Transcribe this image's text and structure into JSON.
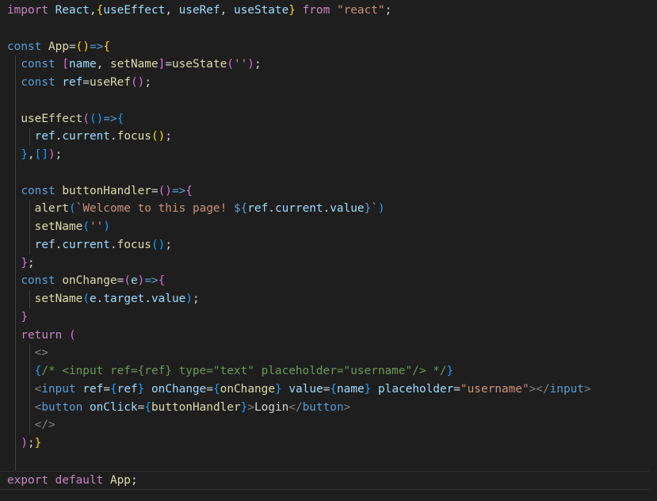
{
  "editor": {
    "language": "javascript-react",
    "current_line": 27,
    "colors": {
      "background": "#1e1e1e",
      "keyword": "#569cd6",
      "control": "#c586c0",
      "variable": "#9cdcfe",
      "function": "#dcdcaa",
      "string": "#ce9178",
      "comment": "#6a9955",
      "component": "#4ec9b0",
      "plain": "#d4d4d4",
      "bracket_gold": "#ffd700",
      "bracket_pink": "#da70d6",
      "bracket_blue": "#179fff",
      "indent_guide": "#404040"
    },
    "lines": [
      {
        "guides": [],
        "tokens": [
          {
            "t": "import",
            "c": "control"
          },
          {
            "t": " ",
            "c": "plain"
          },
          {
            "t": "React",
            "c": "variable"
          },
          {
            "t": ",",
            "c": "plain"
          },
          {
            "t": "{",
            "c": "bracket_gold"
          },
          {
            "t": "useEffect",
            "c": "variable"
          },
          {
            "t": ", ",
            "c": "plain"
          },
          {
            "t": "useRef",
            "c": "variable"
          },
          {
            "t": ", ",
            "c": "plain"
          },
          {
            "t": "useState",
            "c": "variable"
          },
          {
            "t": "}",
            "c": "bracket_gold"
          },
          {
            "t": " ",
            "c": "plain"
          },
          {
            "t": "from",
            "c": "control"
          },
          {
            "t": " ",
            "c": "plain"
          },
          {
            "t": "\"react\"",
            "c": "string"
          },
          {
            "t": ";",
            "c": "plain"
          }
        ]
      },
      {
        "guides": [],
        "tokens": []
      },
      {
        "guides": [],
        "tokens": [
          {
            "t": "const",
            "c": "keyword"
          },
          {
            "t": " ",
            "c": "plain"
          },
          {
            "t": "App",
            "c": "function"
          },
          {
            "t": "=",
            "c": "plain"
          },
          {
            "t": "()",
            "c": "bracket_gold"
          },
          {
            "t": "=>",
            "c": "keyword"
          },
          {
            "t": "{",
            "c": "bracket_gold"
          }
        ]
      },
      {
        "guides": [
          0
        ],
        "tokens": [
          {
            "t": "  ",
            "c": "plain"
          },
          {
            "t": "const",
            "c": "keyword"
          },
          {
            "t": " ",
            "c": "plain"
          },
          {
            "t": "[",
            "c": "bracket_pink"
          },
          {
            "t": "name",
            "c": "variable"
          },
          {
            "t": ", ",
            "c": "plain"
          },
          {
            "t": "setName",
            "c": "function"
          },
          {
            "t": "]",
            "c": "bracket_pink"
          },
          {
            "t": "=",
            "c": "plain"
          },
          {
            "t": "useState",
            "c": "function"
          },
          {
            "t": "(",
            "c": "bracket_pink"
          },
          {
            "t": "''",
            "c": "string"
          },
          {
            "t": ")",
            "c": "bracket_pink"
          },
          {
            "t": ";",
            "c": "plain"
          }
        ]
      },
      {
        "guides": [
          0
        ],
        "tokens": [
          {
            "t": "  ",
            "c": "plain"
          },
          {
            "t": "const",
            "c": "keyword"
          },
          {
            "t": " ",
            "c": "plain"
          },
          {
            "t": "ref",
            "c": "variable"
          },
          {
            "t": "=",
            "c": "plain"
          },
          {
            "t": "useRef",
            "c": "function"
          },
          {
            "t": "()",
            "c": "bracket_pink"
          },
          {
            "t": ";",
            "c": "plain"
          }
        ]
      },
      {
        "guides": [
          0
        ],
        "tokens": []
      },
      {
        "guides": [
          0
        ],
        "tokens": [
          {
            "t": "  ",
            "c": "plain"
          },
          {
            "t": "useEffect",
            "c": "function"
          },
          {
            "t": "(",
            "c": "bracket_pink"
          },
          {
            "t": "()",
            "c": "bracket_blue"
          },
          {
            "t": "=>",
            "c": "keyword"
          },
          {
            "t": "{",
            "c": "bracket_blue"
          }
        ]
      },
      {
        "guides": [
          0,
          1
        ],
        "tokens": [
          {
            "t": "    ",
            "c": "plain"
          },
          {
            "t": "ref",
            "c": "variable"
          },
          {
            "t": ".",
            "c": "plain"
          },
          {
            "t": "current",
            "c": "variable"
          },
          {
            "t": ".",
            "c": "plain"
          },
          {
            "t": "focus",
            "c": "function"
          },
          {
            "t": "()",
            "c": "bracket_gold"
          },
          {
            "t": ";",
            "c": "plain"
          }
        ]
      },
      {
        "guides": [
          0
        ],
        "tokens": [
          {
            "t": "  ",
            "c": "plain"
          },
          {
            "t": "}",
            "c": "bracket_blue"
          },
          {
            "t": ",",
            "c": "plain"
          },
          {
            "t": "[]",
            "c": "bracket_blue"
          },
          {
            "t": ")",
            "c": "bracket_pink"
          },
          {
            "t": ";",
            "c": "plain"
          }
        ]
      },
      {
        "guides": [
          0
        ],
        "tokens": []
      },
      {
        "guides": [
          0
        ],
        "tokens": [
          {
            "t": "  ",
            "c": "plain"
          },
          {
            "t": "const",
            "c": "keyword"
          },
          {
            "t": " ",
            "c": "plain"
          },
          {
            "t": "buttonHandler",
            "c": "function"
          },
          {
            "t": "=",
            "c": "plain"
          },
          {
            "t": "()",
            "c": "bracket_pink"
          },
          {
            "t": "=>",
            "c": "keyword"
          },
          {
            "t": "{",
            "c": "bracket_pink"
          }
        ]
      },
      {
        "guides": [
          0,
          1
        ],
        "tokens": [
          {
            "t": "    ",
            "c": "plain"
          },
          {
            "t": "alert",
            "c": "function"
          },
          {
            "t": "(",
            "c": "bracket_blue"
          },
          {
            "t": "`Welcome to this page! ",
            "c": "string"
          },
          {
            "t": "${",
            "c": "keyword"
          },
          {
            "t": "ref",
            "c": "variable"
          },
          {
            "t": ".",
            "c": "plain"
          },
          {
            "t": "current",
            "c": "variable"
          },
          {
            "t": ".",
            "c": "plain"
          },
          {
            "t": "value",
            "c": "variable"
          },
          {
            "t": "}",
            "c": "keyword"
          },
          {
            "t": "`",
            "c": "string"
          },
          {
            "t": ")",
            "c": "bracket_blue"
          }
        ]
      },
      {
        "guides": [
          0,
          1
        ],
        "tokens": [
          {
            "t": "    ",
            "c": "plain"
          },
          {
            "t": "setName",
            "c": "function"
          },
          {
            "t": "(",
            "c": "bracket_blue"
          },
          {
            "t": "''",
            "c": "string"
          },
          {
            "t": ")",
            "c": "bracket_blue"
          }
        ]
      },
      {
        "guides": [
          0,
          1
        ],
        "tokens": [
          {
            "t": "    ",
            "c": "plain"
          },
          {
            "t": "ref",
            "c": "variable"
          },
          {
            "t": ".",
            "c": "plain"
          },
          {
            "t": "current",
            "c": "variable"
          },
          {
            "t": ".",
            "c": "plain"
          },
          {
            "t": "focus",
            "c": "function"
          },
          {
            "t": "()",
            "c": "bracket_blue"
          },
          {
            "t": ";",
            "c": "plain"
          }
        ]
      },
      {
        "guides": [
          0
        ],
        "tokens": [
          {
            "t": "  ",
            "c": "plain"
          },
          {
            "t": "}",
            "c": "bracket_pink"
          },
          {
            "t": ";",
            "c": "plain"
          }
        ]
      },
      {
        "guides": [
          0
        ],
        "tokens": [
          {
            "t": "  ",
            "c": "plain"
          },
          {
            "t": "const",
            "c": "keyword"
          },
          {
            "t": " ",
            "c": "plain"
          },
          {
            "t": "onChange",
            "c": "function"
          },
          {
            "t": "=",
            "c": "plain"
          },
          {
            "t": "(",
            "c": "bracket_pink"
          },
          {
            "t": "e",
            "c": "variable"
          },
          {
            "t": ")",
            "c": "bracket_pink"
          },
          {
            "t": "=>",
            "c": "keyword"
          },
          {
            "t": "{",
            "c": "bracket_pink"
          }
        ]
      },
      {
        "guides": [
          0,
          1
        ],
        "tokens": [
          {
            "t": "    ",
            "c": "plain"
          },
          {
            "t": "setName",
            "c": "function"
          },
          {
            "t": "(",
            "c": "bracket_blue"
          },
          {
            "t": "e",
            "c": "variable"
          },
          {
            "t": ".",
            "c": "plain"
          },
          {
            "t": "target",
            "c": "variable"
          },
          {
            "t": ".",
            "c": "plain"
          },
          {
            "t": "value",
            "c": "variable"
          },
          {
            "t": ")",
            "c": "bracket_blue"
          },
          {
            "t": ";",
            "c": "plain"
          }
        ]
      },
      {
        "guides": [
          0
        ],
        "tokens": [
          {
            "t": "  ",
            "c": "plain"
          },
          {
            "t": "}",
            "c": "bracket_pink"
          }
        ]
      },
      {
        "guides": [
          0
        ],
        "tokens": [
          {
            "t": "  ",
            "c": "plain"
          },
          {
            "t": "return",
            "c": "control"
          },
          {
            "t": " ",
            "c": "plain"
          },
          {
            "t": "(",
            "c": "bracket_pink"
          }
        ]
      },
      {
        "guides": [
          0,
          1
        ],
        "tokens": [
          {
            "t": "    ",
            "c": "plain"
          },
          {
            "t": "<>",
            "c": "indent_guide"
          }
        ]
      },
      {
        "guides": [
          0,
          1
        ],
        "tokens": [
          {
            "t": "    ",
            "c": "plain"
          },
          {
            "t": "{",
            "c": "bracket_blue"
          },
          {
            "t": "/* <input ref={ref} type=\"text\" placeholder=\"username\"/> */",
            "c": "comment"
          },
          {
            "t": "}",
            "c": "bracket_blue"
          }
        ]
      },
      {
        "guides": [
          0,
          1
        ],
        "tokens": [
          {
            "t": "    ",
            "c": "plain"
          },
          {
            "t": "<",
            "c": "indent_guide"
          },
          {
            "t": "input",
            "c": "keyword"
          },
          {
            "t": " ",
            "c": "plain"
          },
          {
            "t": "ref",
            "c": "variable"
          },
          {
            "t": "=",
            "c": "plain"
          },
          {
            "t": "{",
            "c": "bracket_blue"
          },
          {
            "t": "ref",
            "c": "variable"
          },
          {
            "t": "}",
            "c": "bracket_blue"
          },
          {
            "t": " ",
            "c": "plain"
          },
          {
            "t": "onChange",
            "c": "variable"
          },
          {
            "t": "=",
            "c": "plain"
          },
          {
            "t": "{",
            "c": "bracket_blue"
          },
          {
            "t": "onChange",
            "c": "function"
          },
          {
            "t": "}",
            "c": "bracket_blue"
          },
          {
            "t": " ",
            "c": "plain"
          },
          {
            "t": "value",
            "c": "variable"
          },
          {
            "t": "=",
            "c": "plain"
          },
          {
            "t": "{",
            "c": "bracket_blue"
          },
          {
            "t": "name",
            "c": "variable"
          },
          {
            "t": "}",
            "c": "bracket_blue"
          },
          {
            "t": " ",
            "c": "plain"
          },
          {
            "t": "placeholder",
            "c": "variable"
          },
          {
            "t": "=",
            "c": "plain"
          },
          {
            "t": "\"username\"",
            "c": "string"
          },
          {
            "t": "></",
            "c": "indent_guide"
          },
          {
            "t": "input",
            "c": "keyword"
          },
          {
            "t": ">",
            "c": "indent_guide"
          }
        ]
      },
      {
        "guides": [
          0,
          1
        ],
        "tokens": [
          {
            "t": "    ",
            "c": "plain"
          },
          {
            "t": "<",
            "c": "indent_guide"
          },
          {
            "t": "button",
            "c": "keyword"
          },
          {
            "t": " ",
            "c": "plain"
          },
          {
            "t": "onClick",
            "c": "variable"
          },
          {
            "t": "=",
            "c": "plain"
          },
          {
            "t": "{",
            "c": "bracket_blue"
          },
          {
            "t": "buttonHandler",
            "c": "function"
          },
          {
            "t": "}",
            "c": "bracket_blue"
          },
          {
            "t": ">",
            "c": "indent_guide"
          },
          {
            "t": "Login",
            "c": "plain"
          },
          {
            "t": "</",
            "c": "indent_guide"
          },
          {
            "t": "button",
            "c": "keyword"
          },
          {
            "t": ">",
            "c": "indent_guide"
          }
        ]
      },
      {
        "guides": [
          0,
          1
        ],
        "tokens": [
          {
            "t": "    ",
            "c": "plain"
          },
          {
            "t": "</>",
            "c": "indent_guide"
          }
        ]
      },
      {
        "guides": [
          0
        ],
        "tokens": [
          {
            "t": "  ",
            "c": "plain"
          },
          {
            "t": ")",
            "c": "bracket_pink"
          },
          {
            "t": ";",
            "c": "plain"
          },
          {
            "t": "}",
            "c": "bracket_gold"
          }
        ]
      },
      {
        "guides": [
          0
        ],
        "tokens": []
      },
      {
        "guides": [],
        "tokens": [
          {
            "t": "export",
            "c": "control"
          },
          {
            "t": " ",
            "c": "plain"
          },
          {
            "t": "default",
            "c": "control"
          },
          {
            "t": " ",
            "c": "plain"
          },
          {
            "t": "App",
            "c": "function"
          },
          {
            "t": ";",
            "c": "plain"
          }
        ]
      }
    ]
  }
}
